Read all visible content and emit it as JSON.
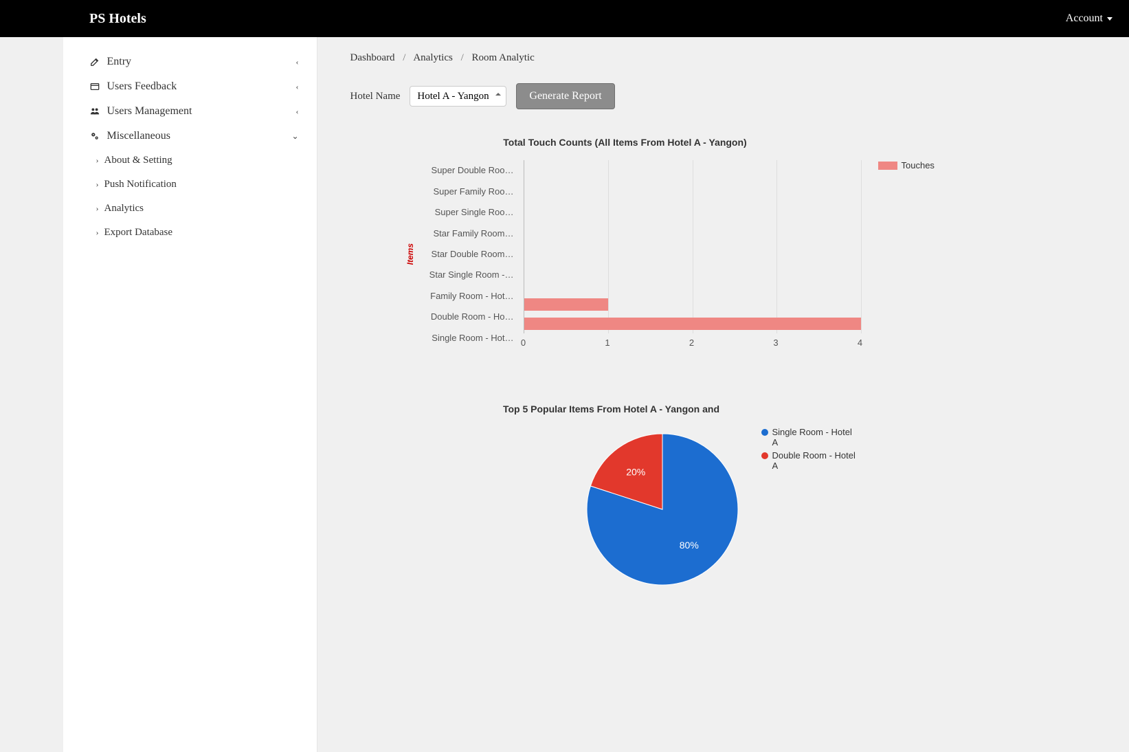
{
  "brand": "PS Hotels",
  "account_label": "Account",
  "sidebar": {
    "entry": "Entry",
    "users_feedback": "Users Feedback",
    "users_management": "Users Management",
    "miscellaneous": "Miscellaneous",
    "about_setting": "About & Setting",
    "push_notification": "Push Notification",
    "analytics": "Analytics",
    "export_database": "Export Database"
  },
  "breadcrumb": {
    "dashboard": "Dashboard",
    "analytics": "Analytics",
    "room_analytic": "Room Analytic"
  },
  "filter": {
    "label": "Hotel Name",
    "selected": "Hotel A - Yangon",
    "button": "Generate Report"
  },
  "chart_data": [
    {
      "type": "bar",
      "orientation": "horizontal",
      "title": "Total Touch Counts (All Items From Hotel A - Yangon)",
      "ylabel": "Items",
      "xlim": [
        0,
        4
      ],
      "xticks": [
        0,
        1,
        2,
        3,
        4
      ],
      "legend": "Touches",
      "legend_color": "#ef8783",
      "categories": [
        "Super Double Roo…",
        "Super Family Roo…",
        "Super Single Roo…",
        "Star Family Room…",
        "Star Double Room…",
        "Star Single Room -…",
        "Family Room - Hot…",
        "Double Room - Ho…",
        "Single Room - Hot…"
      ],
      "values": [
        0,
        0,
        0,
        0,
        0,
        0,
        0,
        1,
        4
      ]
    },
    {
      "type": "pie",
      "title": "Top 5 Popular Items From Hotel A - Yangon and",
      "series": [
        {
          "name": "Single Room - Hotel A",
          "value": 80,
          "label": "80%",
          "color": "#1c6dd0"
        },
        {
          "name": "Double Room - Hotel A",
          "value": 20,
          "label": "20%",
          "color": "#e2382c"
        }
      ]
    }
  ]
}
